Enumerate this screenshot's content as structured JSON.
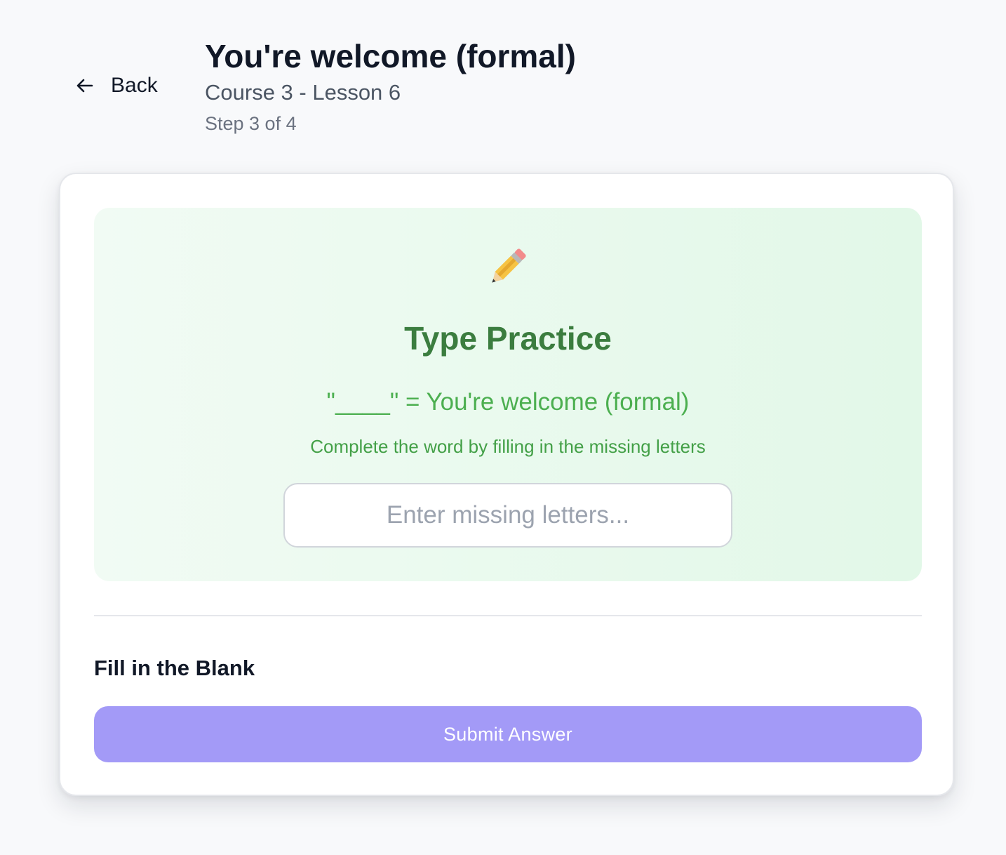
{
  "header": {
    "back_label": "Back",
    "title": "You're welcome (formal)",
    "subtitle": "Course 3 - Lesson 6",
    "step": "Step 3 of 4"
  },
  "practice": {
    "icon": "pencil-icon",
    "title": "Type Practice",
    "prompt": "\"____\" = You're welcome (formal)",
    "instruction": "Complete the word by filling in the missing letters",
    "input_value": "",
    "input_placeholder": "Enter missing letters..."
  },
  "question": {
    "type_label": "Fill in the Blank",
    "submit_label": "Submit Answer"
  },
  "colors": {
    "page_background": "#f8f9fb",
    "practice_title": "#3b7d3f",
    "practice_text": "#4caf50",
    "submit_button": "#a39af7"
  }
}
